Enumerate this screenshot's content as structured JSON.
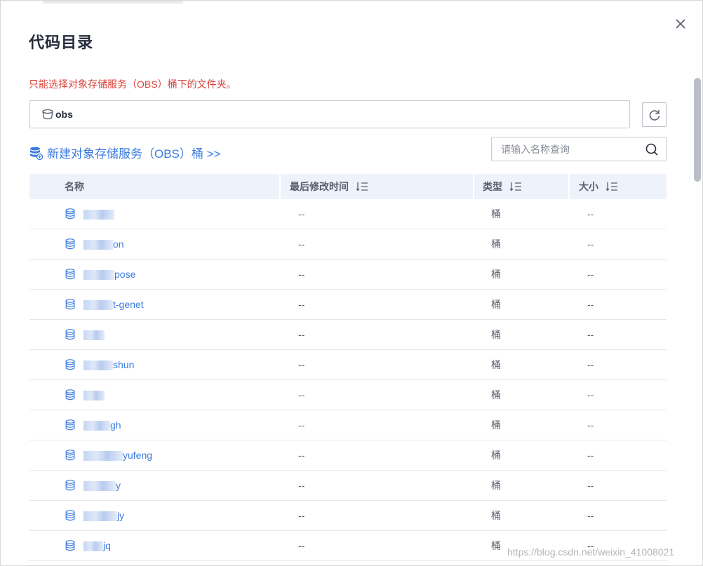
{
  "dialog": {
    "title": "代码目录",
    "hint": "只能选择对象存储服务（OBS）桶下的文件夹。",
    "path": "obs",
    "create_link": "新建对象存储服务（OBS）桶 >>",
    "search_placeholder": "请输入名称查询",
    "watermark": "https://blog.csdn.net/weixin_41008021"
  },
  "table": {
    "headers": {
      "name": "名称",
      "modified": "最后修改时间",
      "type": "类型",
      "size": "大小"
    },
    "rows": [
      {
        "name": "",
        "modified": "--",
        "type": "桶",
        "size": "--"
      },
      {
        "name": "on",
        "modified": "--",
        "type": "桶",
        "size": "--"
      },
      {
        "name": "pose",
        "modified": "--",
        "type": "桶",
        "size": "--"
      },
      {
        "name": "t-genet",
        "modified": "--",
        "type": "桶",
        "size": "--"
      },
      {
        "name": "",
        "modified": "--",
        "type": "桶",
        "size": "--"
      },
      {
        "name": "shun",
        "modified": "--",
        "type": "桶",
        "size": "--"
      },
      {
        "name": "",
        "modified": "--",
        "type": "桶",
        "size": "--"
      },
      {
        "name": "gh",
        "modified": "--",
        "type": "桶",
        "size": "--"
      },
      {
        "name": "yufeng",
        "modified": "--",
        "type": "桶",
        "size": "--"
      },
      {
        "name": "y",
        "modified": "--",
        "type": "桶",
        "size": "--"
      },
      {
        "name": "jy",
        "modified": "--",
        "type": "桶",
        "size": "--"
      },
      {
        "name": "jq",
        "modified": "--",
        "type": "桶",
        "size": "--"
      }
    ]
  },
  "colors": {
    "accent": "#3b7be0",
    "warning": "#d9433b",
    "header_bg": "#eef2fa"
  },
  "icons": {
    "close": "close-icon",
    "bucket": "bucket-icon",
    "refresh": "refresh-icon",
    "create": "create-bucket-icon",
    "search": "search-icon",
    "sort": "sort-icon",
    "row": "database-icon"
  }
}
